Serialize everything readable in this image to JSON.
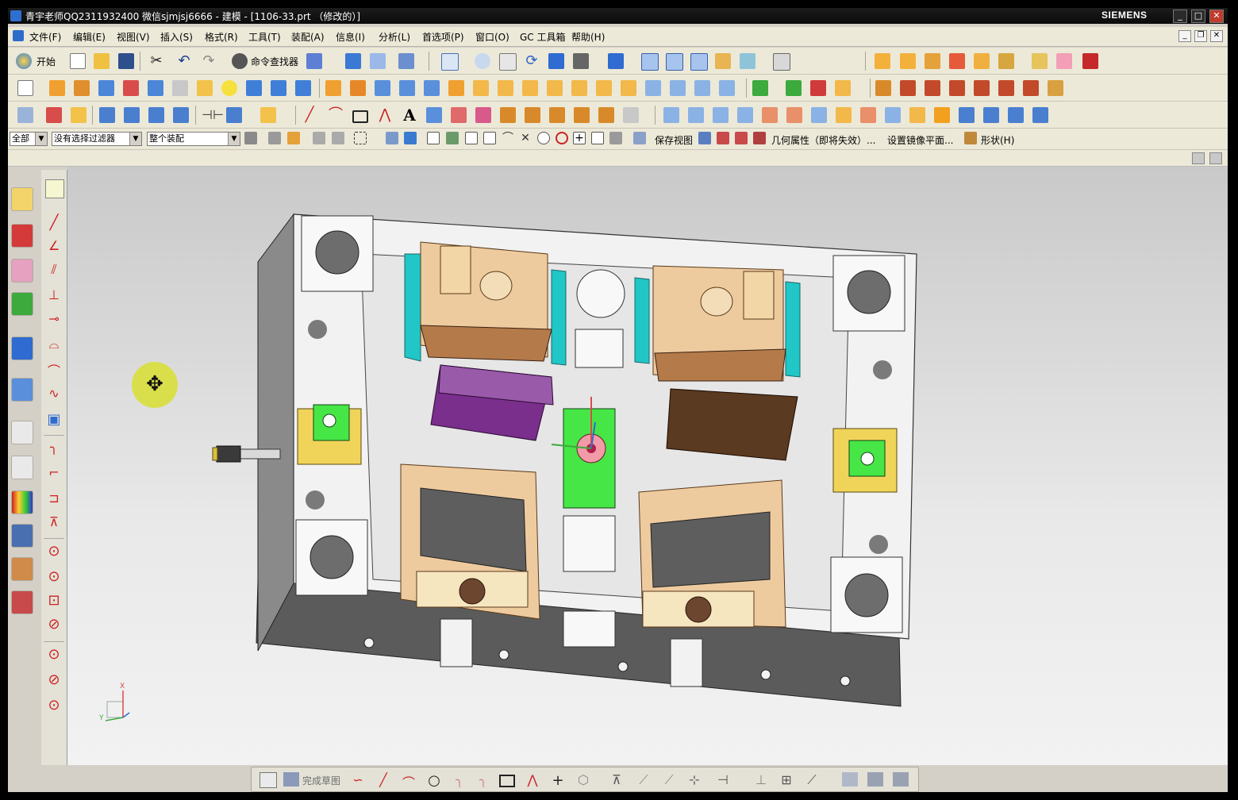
{
  "window": {
    "title": "青宇老师QQ2311932400 微信sjmjsj6666 - 建模 - [1106-33.prt （修改的）]",
    "brand": "SIEMENS",
    "controls": {
      "minimize": "_",
      "maximize": "□",
      "close": "✕"
    }
  },
  "menu": {
    "items": [
      "文件(F)",
      "编辑(E)",
      "视图(V)",
      "插入(S)",
      "格式(R)",
      "工具(T)",
      "装配(A)",
      "信息(I)",
      "分析(L)",
      "首选项(P)",
      "窗口(O)",
      "GC 工具箱",
      "帮助(H)"
    ]
  },
  "toolbar1": {
    "start_label": "开始",
    "command_finder_label": "命令查找器"
  },
  "selection_bar": {
    "type_filter": "全部",
    "selection_filter": "没有选择过滤器",
    "scope": "整个装配",
    "save_view_label": "保存视图",
    "geometry_props_label": "几何属性（即将失效）...",
    "set_mirror_label": "设置镜像平面...",
    "shape_label": "形状(H)"
  },
  "sketch_bottom": {
    "finish_sketch_label": "完成草图"
  },
  "triad": {
    "x_label": "X",
    "y_label": "Y"
  },
  "colors": {
    "accent_green": "#46e646",
    "accent_purple": "#7a2f8c",
    "accent_cyan": "#21c6c6",
    "accent_tan": "#e8c79a",
    "cursor_yellow": "#d8df3a"
  }
}
